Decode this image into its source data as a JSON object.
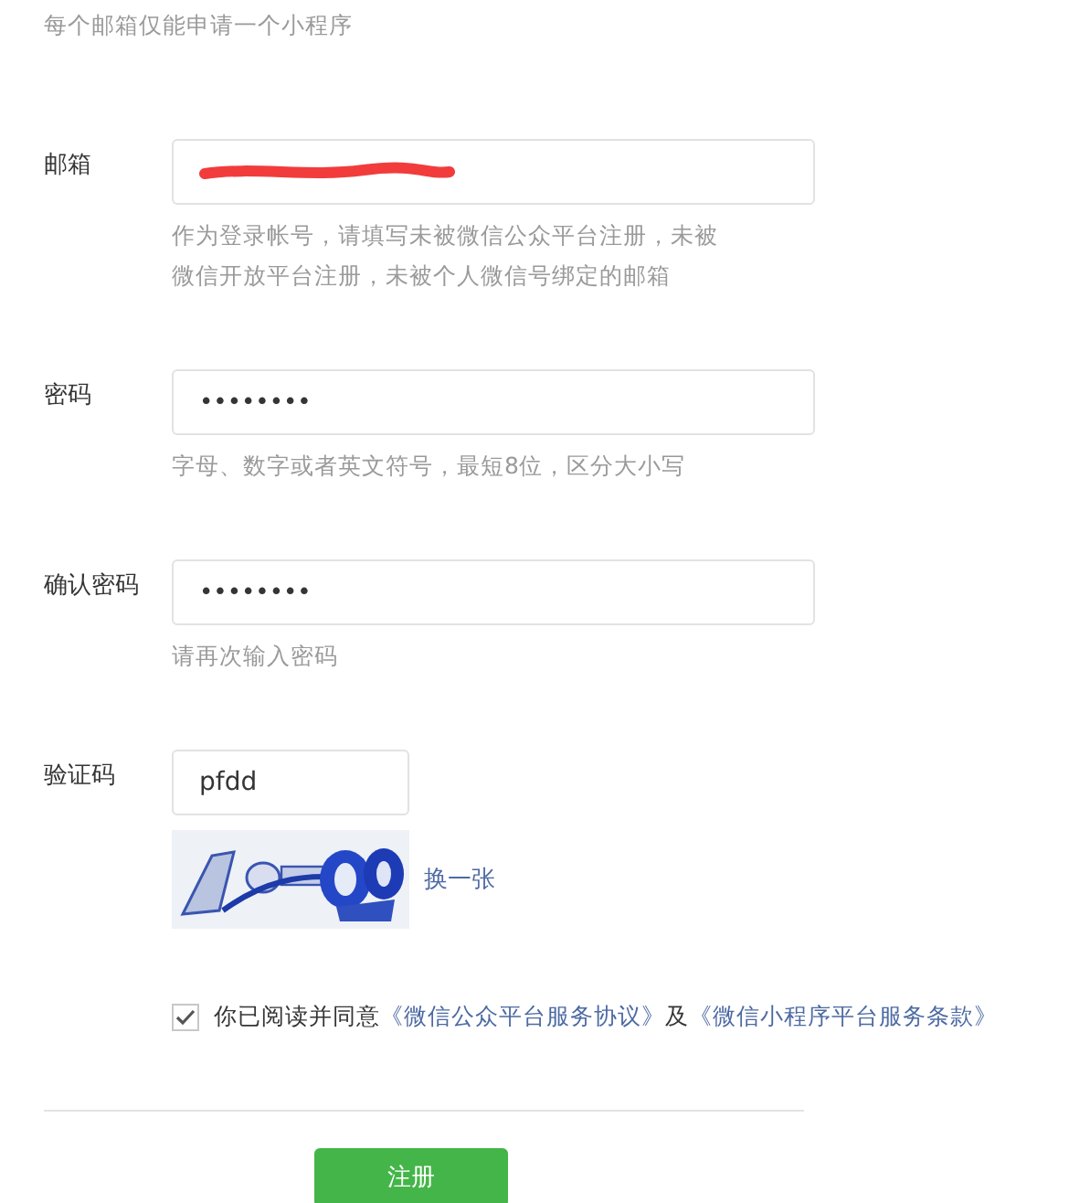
{
  "intro": "每个邮箱仅能申请一个小程序",
  "fields": [
    {
      "label": "邮箱",
      "kind": "email",
      "redacted": true,
      "hint": "作为登录帐号，请填写未被微信公众平台注册，未被微信开放平台注册，未被个人微信号绑定的邮箱"
    },
    {
      "label": "密码",
      "kind": "password",
      "value": "••••••••",
      "hint": "字母、数字或者英文符号，最短8位，区分大小写"
    },
    {
      "label": "确认密码",
      "kind": "password",
      "value": "••••••••",
      "hint": "请再次输入密码"
    }
  ],
  "captcha": {
    "label": "验证码",
    "value": "pfdd",
    "refresh": "换一张"
  },
  "agreement": {
    "checked": true,
    "text": "你已阅读并同意",
    "link_1": "《微信公众平台服务协议》",
    "joiner": "及",
    "link_2": "《微信小程序平台服务条款》"
  },
  "submit": "注册"
}
